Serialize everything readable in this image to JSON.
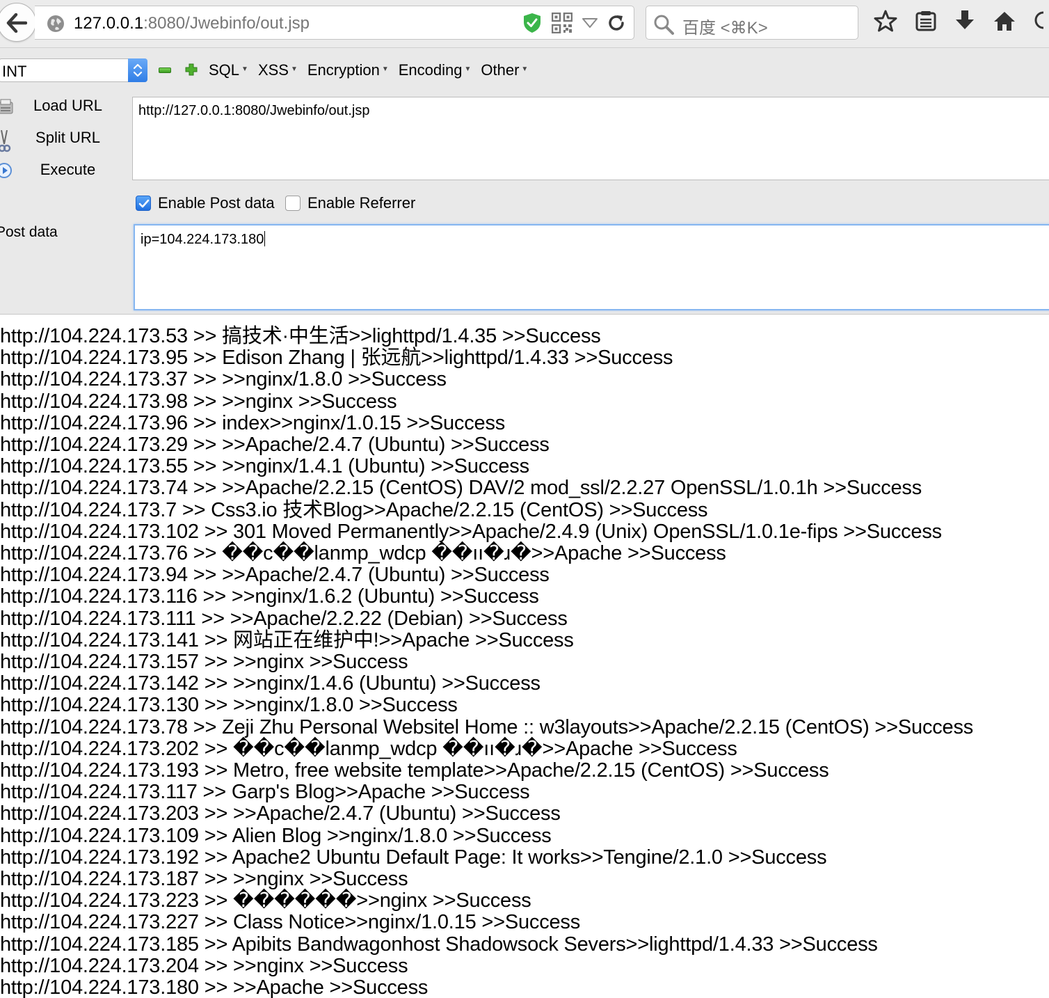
{
  "browser": {
    "url_host": "127.0.0.1",
    "url_rest": ":8080/Jwebinfo/out.jsp",
    "search_placeholder": "百度 <⌘K>"
  },
  "hackbar": {
    "select_value": "INT",
    "menus": [
      "SQL",
      "XSS",
      "Encryption",
      "Encoding",
      "Other"
    ],
    "load_url": "Load URL",
    "split_url": "Split URL",
    "execute": "Execute",
    "url_value": "http://127.0.0.1:8080/Jwebinfo/out.jsp",
    "enable_post": "Enable Post data",
    "enable_post_checked": true,
    "enable_referrer": "Enable Referrer",
    "enable_referrer_checked": false,
    "post_label": "Post data",
    "post_value": "ip=104.224.173.180"
  },
  "output": [
    "http://104.224.173.53 >> 搞技术·中生活>>lighttpd/1.4.35 >>Success",
    "http://104.224.173.95 >> Edison Zhang | 张远航>>lighttpd/1.4.33 >>Success",
    "http://104.224.173.37 >> >>nginx/1.8.0 >>Success",
    "http://104.224.173.98 >> >>nginx >>Success",
    "http://104.224.173.96 >> index>>nginx/1.0.15 >>Success",
    "http://104.224.173.29 >> >>Apache/2.4.7 (Ubuntu) >>Success",
    "http://104.224.173.55 >> >>nginx/1.4.1 (Ubuntu) >>Success",
    "http://104.224.173.74 >> >>Apache/2.2.15 (CentOS) DAV/2 mod_ssl/2.2.27 OpenSSL/1.0.1h >>Success",
    "http://104.224.173.7 >> Css3.io 技术Blog>>Apache/2.2.15 (CentOS) >>Success",
    "http://104.224.173.102 >> 301 Moved Permanently>>Apache/2.4.9 (Unix) OpenSSL/1.0.1e-fips >>Success",
    "http://104.224.173.76 >> ��c��lanmp_wdcp ��ıı�ɹ�>>Apache >>Success",
    "http://104.224.173.94 >> >>Apache/2.4.7 (Ubuntu) >>Success",
    "http://104.224.173.116 >> >>nginx/1.6.2 (Ubuntu) >>Success",
    "http://104.224.173.111 >> >>Apache/2.2.22 (Debian) >>Success",
    "http://104.224.173.141 >> 网站正在维护中!>>Apache >>Success",
    "http://104.224.173.157 >> >>nginx >>Success",
    "http://104.224.173.142 >> >>nginx/1.4.6 (Ubuntu) >>Success",
    "http://104.224.173.130 >> >>nginx/1.8.0 >>Success",
    "http://104.224.173.78 >> Zeji Zhu Personal Websitel Home :: w3layouts>>Apache/2.2.15 (CentOS) >>Success",
    "http://104.224.173.202 >> ��c��lanmp_wdcp ��ıı�ɹ�>>Apache >>Success",
    "http://104.224.173.193 >> Metro, free website template>>Apache/2.2.15 (CentOS) >>Success",
    "http://104.224.173.117 >> Garp's Blog>>Apache >>Success",
    "http://104.224.173.203 >> >>Apache/2.4.7 (Ubuntu) >>Success",
    "http://104.224.173.109 >> Alien Blog >>nginx/1.8.0 >>Success",
    "http://104.224.173.192 >> Apache2 Ubuntu Default Page: It works>>Tengine/2.1.0 >>Success",
    "http://104.224.173.187 >> >>nginx >>Success",
    "http://104.224.173.223 >> ������>>nginx >>Success",
    "http://104.224.173.227 >> Class Notice>>nginx/1.0.15 >>Success",
    "http://104.224.173.185 >> Apibits Bandwagonhost Shadowsock Severs>>lighttpd/1.4.33 >>Success",
    "http://104.224.173.204 >> >>nginx >>Success",
    "http://104.224.173.180 >> >>Apache >>Success"
  ]
}
